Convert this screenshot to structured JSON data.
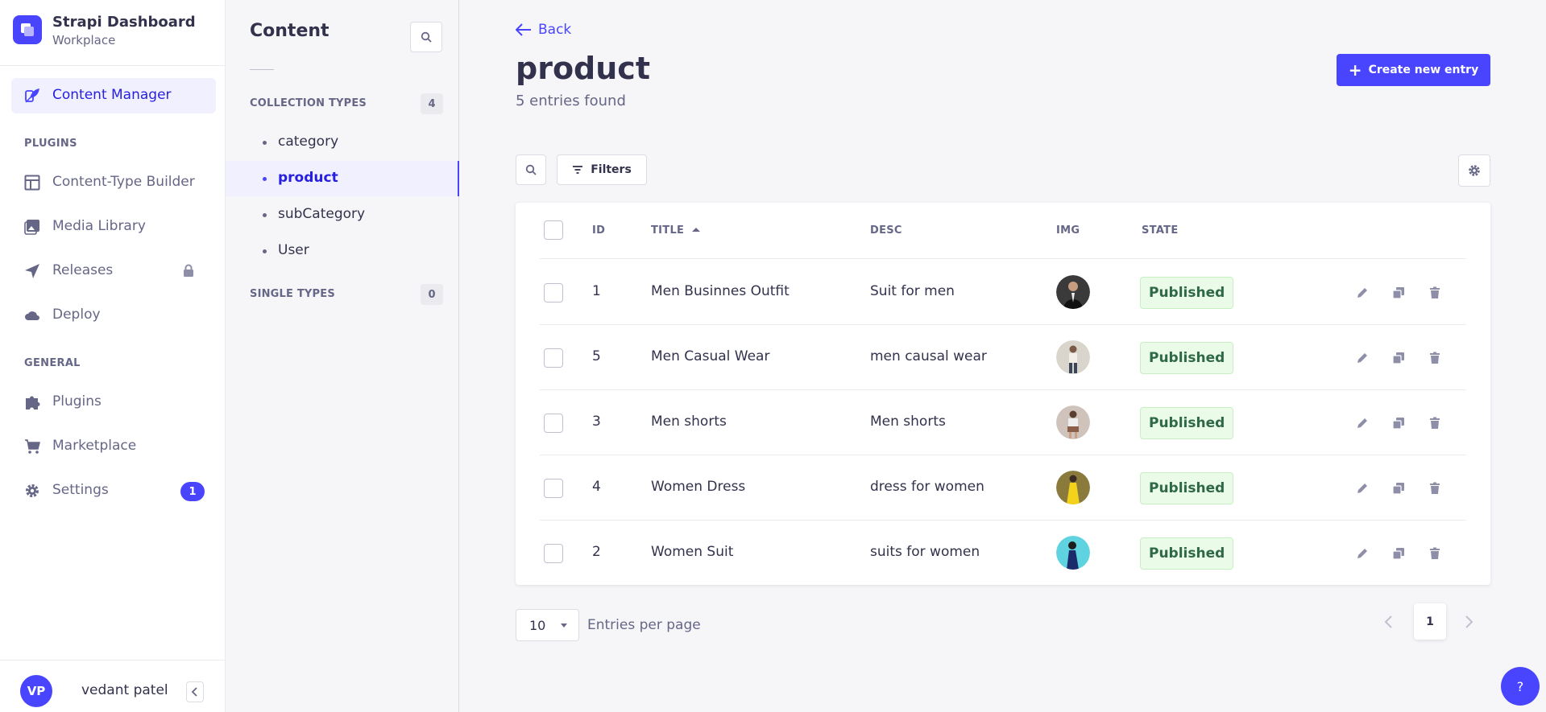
{
  "brand": {
    "title": "Strapi Dashboard",
    "subtitle": "Workplace"
  },
  "nav": {
    "content_manager": "Content Manager",
    "plugins_heading": "PLUGINS",
    "plugins": [
      "Content-Type Builder",
      "Media Library",
      "Releases",
      "Deploy"
    ],
    "general_heading": "GENERAL",
    "general": [
      "Plugins",
      "Marketplace",
      "Settings"
    ],
    "settings_badge": "1"
  },
  "profile": {
    "initials": "VP",
    "name": "vedant patel"
  },
  "subnav": {
    "title": "Content",
    "collection_heading": "COLLECTION TYPES",
    "collection_count": "4",
    "collection_items": [
      "category",
      "product",
      "subCategory",
      "User"
    ],
    "single_heading": "SINGLE TYPES",
    "single_count": "0"
  },
  "main": {
    "back_label": "Back",
    "title": "product",
    "subtitle": "5 entries found",
    "create_label": "Create new entry",
    "filters_label": "Filters"
  },
  "table": {
    "columns": [
      "ID",
      "TITLE",
      "DESC",
      "IMG",
      "STATE"
    ],
    "rows": [
      {
        "id": "1",
        "title": "Men Businnes Outfit",
        "desc": "Suit for men",
        "state": "Published"
      },
      {
        "id": "5",
        "title": "Men Casual Wear",
        "desc": "men causal wear",
        "state": "Published"
      },
      {
        "id": "3",
        "title": "Men shorts",
        "desc": "Men shorts",
        "state": "Published"
      },
      {
        "id": "4",
        "title": "Women Dress",
        "desc": "dress for women",
        "state": "Published"
      },
      {
        "id": "2",
        "title": "Women Suit",
        "desc": "suits for women",
        "state": "Published"
      }
    ]
  },
  "pagination": {
    "per_page": "10",
    "per_page_label": "Entries per page",
    "current_page": "1"
  },
  "help": {
    "label": "?"
  },
  "colors": {
    "primary": "#4945ff",
    "published_bg": "#eafbe7",
    "published_text": "#2f6846"
  }
}
